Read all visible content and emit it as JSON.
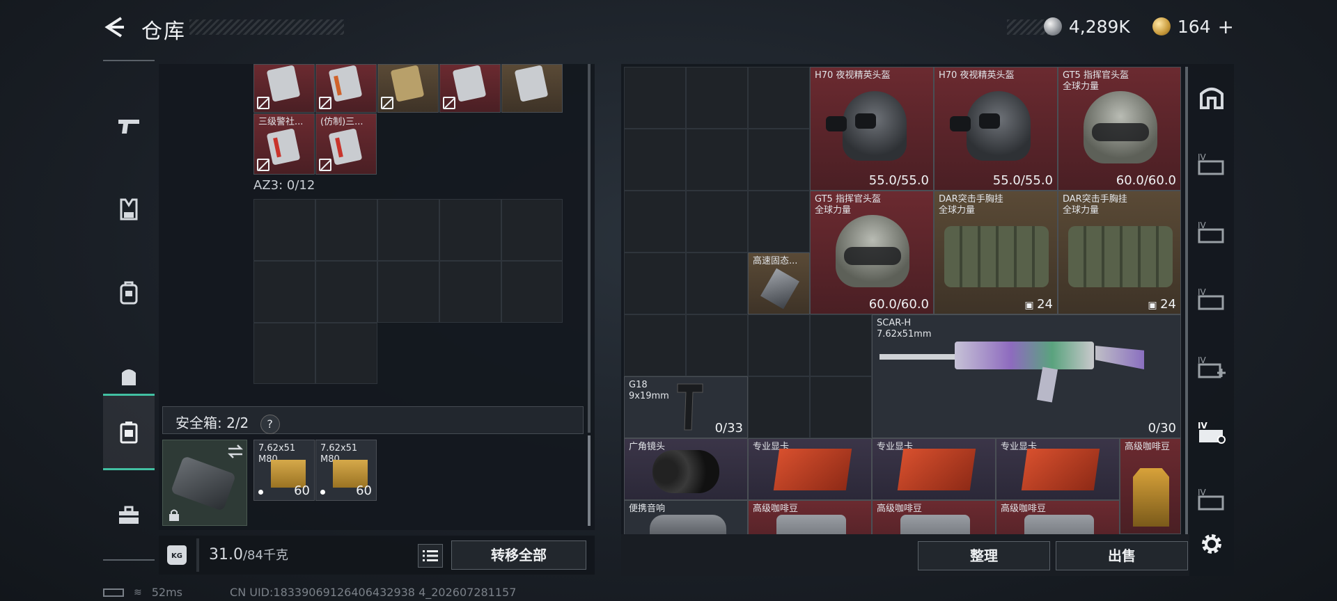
{
  "header": {
    "title": "仓库",
    "silver_amount": "4,289K",
    "gold_amount": "164",
    "plus": "+"
  },
  "sidebar": {
    "items": [
      {
        "name": "weapon",
        "icon": "pistol-icon"
      },
      {
        "name": "vest",
        "icon": "chest-rig-icon"
      },
      {
        "name": "backpack",
        "icon": "backpack-icon"
      },
      {
        "name": "bag",
        "icon": "bag-icon"
      },
      {
        "name": "safebox",
        "icon": "safebox-icon",
        "active": true
      },
      {
        "name": "toolbox",
        "icon": "toolbox-icon"
      }
    ]
  },
  "left": {
    "top_items": [
      {
        "label": "",
        "color": "red"
      },
      {
        "label": "",
        "color": "red"
      },
      {
        "label": "",
        "color": "brown"
      },
      {
        "label": "",
        "color": "red"
      },
      {
        "label": "",
        "color": "brown"
      }
    ],
    "second_items": [
      {
        "label": "三级警社...",
        "color": "red"
      },
      {
        "label": "(仿制)三...",
        "color": "red"
      }
    ],
    "az3_label": "AZ3: 0/12",
    "safe_title": "安全箱: 2/2",
    "safe_help": "?",
    "safe_items": [
      {
        "label": "7.62x51",
        "sub": "M80",
        "count": "60"
      },
      {
        "label": "7.62x51",
        "sub": "M80",
        "count": "60"
      }
    ]
  },
  "bottom_left": {
    "weight_value": "31.0",
    "weight_max": "/84千克",
    "transfer_all": "转移全部",
    "kg_badge": "KG"
  },
  "right": {
    "helmets": [
      {
        "name": "H70 夜视精英头盔",
        "value": "55.0/55.0"
      },
      {
        "name": "H70 夜视精英头盔",
        "value": "55.0/55.0"
      },
      {
        "name": "GT5 指挥官头盔",
        "sub": "全球力量",
        "value": "60.0/60.0"
      },
      {
        "name": "GT5 指挥官头盔",
        "sub": "全球力量",
        "value": "60.0/60.0"
      }
    ],
    "rigs": [
      {
        "name": "DAR突击手胸挂",
        "sub": "全球力量",
        "value": "24"
      },
      {
        "name": "DAR突击手胸挂",
        "sub": "全球力量",
        "value": "24"
      }
    ],
    "ssd": {
      "name": "高速固态..."
    },
    "scar": {
      "name": "SCAR-H",
      "sub": "7.62x51mm",
      "ammo": "0/30"
    },
    "g18": {
      "name": "G18",
      "sub": "9x19mm",
      "ammo": "0/33"
    },
    "row4": [
      {
        "name": "广角镜头"
      },
      {
        "name": "专业显卡"
      },
      {
        "name": "专业显卡"
      },
      {
        "name": "专业显卡"
      },
      {
        "name": "高级咖啡豆"
      }
    ],
    "row5": [
      {
        "name": "便携音响"
      },
      {
        "name": "高级咖啡豆"
      },
      {
        "name": "高级咖啡豆"
      },
      {
        "name": "高级咖啡豆"
      }
    ],
    "sort_button": "整理",
    "sell_button": "出售"
  },
  "right_tabs": [
    {
      "icon": "storage-icon"
    },
    {
      "icon": "expansion-box-icon",
      "label": "IV"
    },
    {
      "icon": "expansion-box-icon",
      "label": "IV"
    },
    {
      "icon": "expansion-box-icon",
      "label": "IV"
    },
    {
      "icon": "expansion-box-add-icon",
      "label": "IV"
    },
    {
      "icon": "expansion-box-active-icon",
      "label": "IV"
    },
    {
      "icon": "expansion-box-icon",
      "label": "IV"
    }
  ],
  "status": {
    "ping": "52ms",
    "uid": "CN UID:18339069126406432938 4_202607281157"
  }
}
